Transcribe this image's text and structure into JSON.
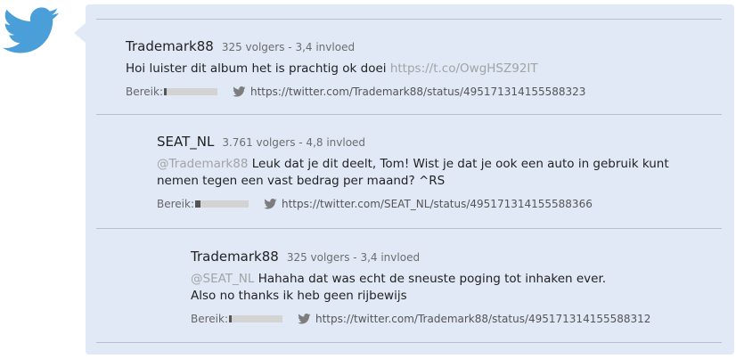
{
  "colors": {
    "twitter_blue": "#4a9fd9",
    "panel_bg": "#e1e9f7",
    "divider": "#b9c0cc",
    "muted_text": "#a3a3a3",
    "reach_fill": "#555555",
    "reach_track": "#d3d3d3"
  },
  "icons": {
    "logo": "twitter-bird-icon",
    "status": "twitter-bird-small-icon"
  },
  "reach_label": "Bereik:",
  "thread": [
    {
      "user": "Trademark88",
      "stats": "325 volgers - 3,4 invloed",
      "mention": "",
      "text": "Hoi luister dit album het is prachtig ok doei ",
      "text_link": "https://t.co/OwgHSZ92IT",
      "text_line2": "",
      "reach": 0.05,
      "status_url": "https://twitter.com/Trademark88/status/495171314155588323"
    },
    {
      "user": "SEAT_NL",
      "stats": "3.761 volgers - 4,8 invloed",
      "mention": "@Trademark88",
      "text": " Leuk dat je dit deelt, Tom! Wist je dat je ook een auto in gebruik kunt nemen tegen een vast bedrag per maand? ^RS",
      "text_link": "",
      "text_line2": "",
      "reach": 0.1,
      "status_url": "https://twitter.com/SEAT_NL/status/495171314155588366"
    },
    {
      "user": "Trademark88",
      "stats": "325 volgers - 3,4 invloed",
      "mention": "@SEAT_NL",
      "text": " Hahaha dat was echt de sneuste poging tot inhaken ever.",
      "text_link": "",
      "text_line2": "Also no thanks ik heb geen rijbewijs",
      "reach": 0.05,
      "status_url": "https://twitter.com/Trademark88/status/495171314155588312"
    }
  ]
}
